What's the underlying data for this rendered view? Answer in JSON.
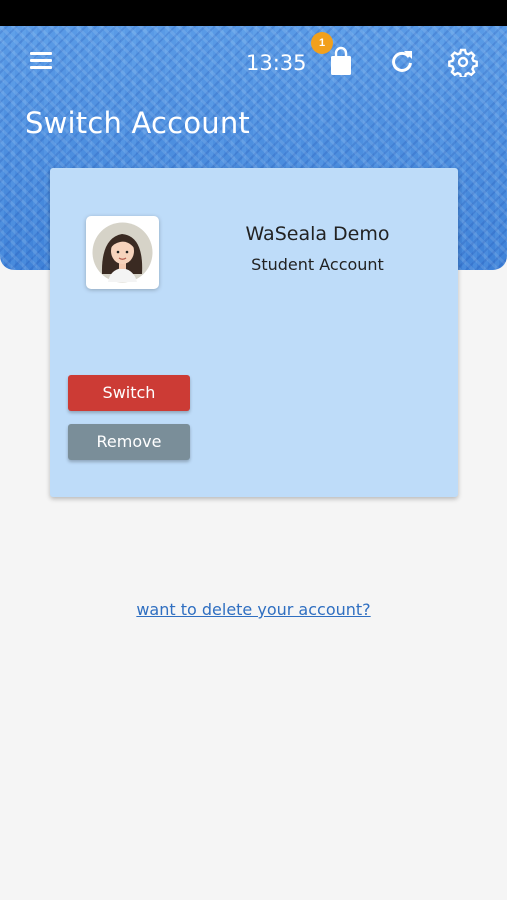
{
  "status_bar": {
    "color": "#000000"
  },
  "header": {
    "time": "13:35",
    "cart_badge": "1",
    "title": "Switch Account",
    "icons": [
      "menu-icon",
      "shopping-bag-icon",
      "refresh-icon",
      "gear-icon"
    ],
    "accent": "#4d8fe0",
    "badge_color": "#f2a01c"
  },
  "account": {
    "name": "WaSeala Demo",
    "type": "Student Account",
    "avatar_icon": "avatar-girl-icon"
  },
  "actions": {
    "switch_label": "Switch",
    "switch_color": "#cc3b35",
    "remove_label": "Remove",
    "remove_color": "#7a8e99"
  },
  "footer": {
    "delete_link": "want to delete your account?"
  }
}
